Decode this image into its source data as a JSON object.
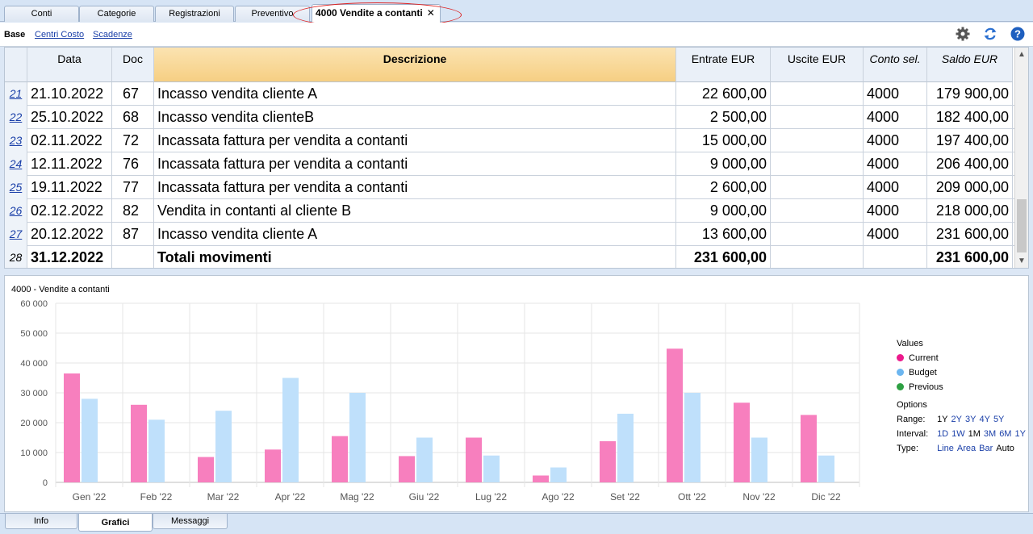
{
  "tabs": [
    {
      "label": "Conti"
    },
    {
      "label": "Categorie"
    },
    {
      "label": "Registrazioni"
    },
    {
      "label": "Preventivo"
    },
    {
      "label": "4000 Vendite a contanti",
      "close": "✕"
    }
  ],
  "subbar": {
    "base": "Base",
    "links": [
      "Centri Costo",
      "Scadenze"
    ]
  },
  "toolbar_icons": [
    "gear-icon",
    "refresh-icon",
    "help-icon"
  ],
  "table": {
    "headers": [
      "Data",
      "Doc",
      "Descrizione",
      "Entrate EUR",
      "Uscite EUR",
      "Conto sel.",
      "Saldo EUR"
    ],
    "rows": [
      {
        "n": "21",
        "data": "21.10.2022",
        "doc": "67",
        "desc": "Incasso vendita cliente A",
        "entrate": "22 600,00",
        "uscite": "",
        "conto": "4000",
        "saldo": "179 900,00"
      },
      {
        "n": "22",
        "data": "25.10.2022",
        "doc": "68",
        "desc": "Incasso vendita clienteB",
        "entrate": "2 500,00",
        "uscite": "",
        "conto": "4000",
        "saldo": "182 400,00"
      },
      {
        "n": "23",
        "data": "02.11.2022",
        "doc": "72",
        "desc": "Incassata fattura per vendita a contanti",
        "entrate": "15 000,00",
        "uscite": "",
        "conto": "4000",
        "saldo": "197 400,00"
      },
      {
        "n": "24",
        "data": "12.11.2022",
        "doc": "76",
        "desc": "Incassata fattura per vendita a contanti",
        "entrate": "9 000,00",
        "uscite": "",
        "conto": "4000",
        "saldo": "206 400,00"
      },
      {
        "n": "25",
        "data": "19.11.2022",
        "doc": "77",
        "desc": "Incassata fattura per vendita a contanti",
        "entrate": "2 600,00",
        "uscite": "",
        "conto": "4000",
        "saldo": "209 000,00"
      },
      {
        "n": "26",
        "data": "02.12.2022",
        "doc": "82",
        "desc": "Vendita in contanti al cliente B",
        "entrate": "9 000,00",
        "uscite": "",
        "conto": "4000",
        "saldo": "218 000,00"
      },
      {
        "n": "27",
        "data": "20.12.2022",
        "doc": "87",
        "desc": "Incasso vendita cliente A",
        "entrate": "13 600,00",
        "uscite": "",
        "conto": "4000",
        "saldo": "231 600,00"
      },
      {
        "n": "28",
        "data": "31.12.2022",
        "doc": "",
        "desc": "Totali movimenti",
        "entrate": "231 600,00",
        "uscite": "",
        "conto": "",
        "saldo": "231 600,00",
        "total": true
      }
    ]
  },
  "chart_data": {
    "type": "bar",
    "title": "4000 - Vendite a contanti",
    "categories": [
      "Gen '22",
      "Feb '22",
      "Mar '22",
      "Apr '22",
      "Mag '22",
      "Giu '22",
      "Lug '22",
      "Ago '22",
      "Set '22",
      "Ott '22",
      "Nov '22",
      "Dic '22"
    ],
    "series": [
      {
        "name": "Current",
        "color": "#f77fbe",
        "values": [
          36500,
          26000,
          8500,
          11000,
          15500,
          8800,
          15000,
          2300,
          13800,
          44800,
          26700,
          22600
        ]
      },
      {
        "name": "Budget",
        "color": "#bfe0fb",
        "values": [
          28000,
          21000,
          24000,
          35000,
          30000,
          15000,
          9000,
          5000,
          23000,
          30000,
          15000,
          9000
        ]
      }
    ],
    "ylim": [
      0,
      60000
    ],
    "yticks": [
      "0",
      "10 000",
      "20 000",
      "30 000",
      "40 000",
      "50 000",
      "60 000"
    ],
    "grid": true,
    "legend_position": "right"
  },
  "legend": {
    "title": "Values",
    "items": [
      {
        "label": "Current",
        "color": "#ec1a8c"
      },
      {
        "label": "Budget",
        "color": "#6cb6f0"
      },
      {
        "label": "Previous",
        "color": "#2ea043"
      }
    ],
    "options_title": "Options",
    "range": {
      "label": "Range:",
      "values": [
        "1Y",
        "2Y",
        "3Y",
        "4Y",
        "5Y"
      ],
      "selected": "1Y"
    },
    "interval": {
      "label": "Interval:",
      "values": [
        "1D",
        "1W",
        "1M",
        "3M",
        "6M",
        "1Y"
      ],
      "selected": "1M"
    },
    "type": {
      "label": "Type:",
      "values": [
        "Line",
        "Area",
        "Bar",
        "Auto"
      ],
      "selected": "Auto"
    }
  },
  "bottom_tabs": [
    {
      "label": "Info"
    },
    {
      "label": "Grafici",
      "active": true
    },
    {
      "label": "Messaggi"
    }
  ]
}
